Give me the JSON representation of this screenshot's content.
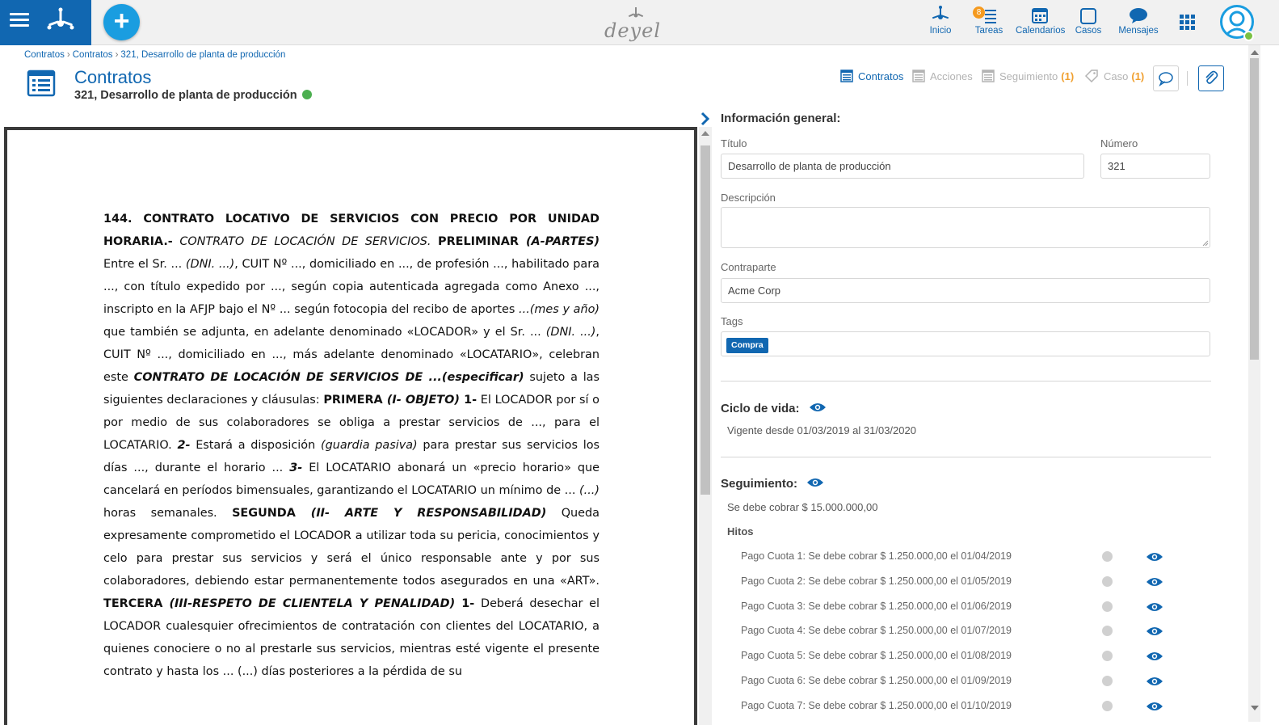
{
  "nav": {
    "items": [
      {
        "label": "Inicio",
        "icon": "home-logo-icon"
      },
      {
        "label": "Tareas",
        "icon": "tasks-icon",
        "badge": "8"
      },
      {
        "label": "Calendarios",
        "icon": "calendar-icon"
      },
      {
        "label": "Casos",
        "icon": "cases-icon"
      },
      {
        "label": "Mensajes",
        "icon": "messages-icon"
      }
    ],
    "brand": "deyel",
    "accent": "#1167b1"
  },
  "breadcrumb": [
    "Contratos",
    "Contratos",
    "321, Desarrollo de planta de producción"
  ],
  "header": {
    "title": "Contratos",
    "subtitle": "321, Desarrollo de planta de producción",
    "status_color": "#4caf50"
  },
  "tabs": [
    {
      "label": "Contratos",
      "count": ""
    },
    {
      "label": "Acciones",
      "count": ""
    },
    {
      "label": "Seguimiento",
      "count": "(1)"
    },
    {
      "label": "Caso",
      "count": "(1)"
    }
  ],
  "document": {
    "paragraph_html": "<b>144. CONTRATO LOCATIVO DE SERVICIOS CON PRECIO POR UNIDAD HORARIA.-</b> <i>CONTRATO DE LOCACIÓN DE SERVICIOS.</i> <b>PRELIMINAR <i>(A-PARTES)</i></b> Entre el Sr. ... <i>(DNI. ...)</i>, CUIT Nº ..., domiciliado en ..., de profesión ..., habilitado para ..., con título expedido por ..., según copia autenticada agregada como Anexo ..., inscripto en la AFJP bajo el Nº ... según fotocopia del recibo de aportes <i>...(mes y año)</i> que también se adjunta, en adelante denominado «LOCADOR» y el Sr. ... <i>(DNI. ...)</i>, CUIT Nº ..., domiciliado en ..., más adelante denominado «LOCATARIO», celebran este <b><i>CONTRATO DE LOCACIÓN DE SERVICIOS DE ...(especificar)</i></b> sujeto a las siguientes declaraciones y cláusulas: <b>PRIMERA <i>(I- OBJETO)</i> 1-</b> El LOCADOR por sí o por medio de sus colaboradores se obliga a prestar servicios de ..., para el LOCATARIO. <b><i>2-</i></b> Estará a disposición <i>(guardia pasiva)</i> para prestar sus servicios los días ..., durante el horario ... <b><i>3-</i></b> El LOCATARIO abonará un «precio horario» que cancelará en períodos bimensuales, garantizando el LOCATARIO un mínimo de ... <i>(...)</i> horas semanales. <b>SEGUNDA <i>(II- ARTE Y RESPONSABILIDAD)</i></b> Queda expresamente comprometido el LOCADOR a utilizar toda su pericia, conocimientos y celo para prestar sus servicios y será el único responsable ante y por sus colaboradores, debiendo estar permanentemente todos asegurados en una «ART». <b>TERCERA <i>(III-RESPETO DE CLIENTELA Y PENALIDAD)</i> 1-</b> Deberá desechar el LOCADOR cualesquier ofrecimientos de contratación con clientes del LOCATARIO, a quienes conociere o no al prestarle sus servicios, mientras esté vigente el presente contrato y hasta los ... (...) días posteriores a la pérdida de su"
  },
  "form": {
    "section_title": "Información general:",
    "titulo_label": "Título",
    "titulo_value": "Desarrollo de planta de producción",
    "numero_label": "Número",
    "numero_value": "321",
    "descripcion_label": "Descripción",
    "descripcion_value": "",
    "contraparte_label": "Contraparte",
    "contraparte_value": "Acme Corp",
    "tags_label": "Tags",
    "tags": [
      "Compra"
    ]
  },
  "ciclo": {
    "title": "Ciclo de vida:",
    "text": "Vigente desde 01/03/2019 al 31/03/2020"
  },
  "seguimiento": {
    "title": "Seguimiento:",
    "text": "Se debe cobrar $ 15.000.000,00",
    "hitos_title": "Hitos",
    "hitos": [
      "Pago Cuota 1: Se debe cobrar $ 1.250.000,00 el 01/04/2019",
      "Pago Cuota 2: Se debe cobrar $ 1.250.000,00 el 01/05/2019",
      "Pago Cuota 3: Se debe cobrar $ 1.250.000,00 el 01/06/2019",
      "Pago Cuota 4: Se debe cobrar $ 1.250.000,00 el 01/07/2019",
      "Pago Cuota 5: Se debe cobrar $ 1.250.000,00 el 01/08/2019",
      "Pago Cuota 6: Se debe cobrar $ 1.250.000,00 el 01/09/2019",
      "Pago Cuota 7: Se debe cobrar $ 1.250.000,00 el 01/10/2019"
    ]
  }
}
